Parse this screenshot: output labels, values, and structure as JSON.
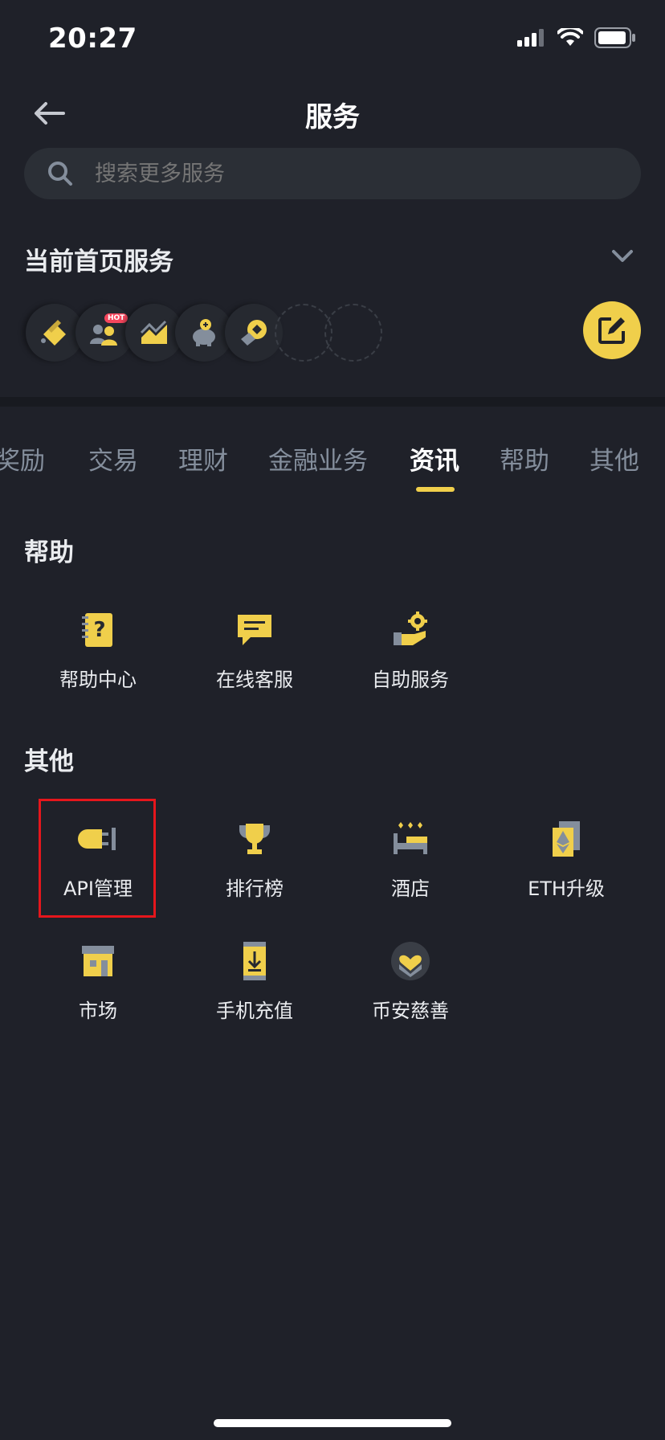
{
  "status_bar": {
    "time": "20:27"
  },
  "header": {
    "title": "服务"
  },
  "search": {
    "placeholder": "搜索更多服务"
  },
  "current_services": {
    "title": "当前首页服务",
    "hot_badge": "HOT",
    "slots": [
      "binance-card-icon",
      "referral-icon",
      "trading-chart-icon",
      "savings-piggy-icon",
      "pay-icon",
      "empty",
      "empty"
    ]
  },
  "tabs": [
    {
      "label": "奖励",
      "active": false
    },
    {
      "label": "交易",
      "active": false
    },
    {
      "label": "理财",
      "active": false
    },
    {
      "label": "金融业务",
      "active": false
    },
    {
      "label": "资讯",
      "active": true
    },
    {
      "label": "帮助",
      "active": false
    },
    {
      "label": "其他",
      "active": false
    }
  ],
  "groups": {
    "help": {
      "title": "帮助",
      "items": [
        {
          "label": "帮助中心",
          "icon": "help-center-icon"
        },
        {
          "label": "在线客服",
          "icon": "chat-icon"
        },
        {
          "label": "自助服务",
          "icon": "self-service-icon"
        }
      ]
    },
    "other": {
      "title": "其他",
      "items": [
        {
          "label": "API管理",
          "icon": "plug-icon"
        },
        {
          "label": "排行榜",
          "icon": "trophy-icon"
        },
        {
          "label": "酒店",
          "icon": "hotel-icon"
        },
        {
          "label": "ETH升级",
          "icon": "eth-icon"
        },
        {
          "label": "市场",
          "icon": "market-icon"
        },
        {
          "label": "手机充值",
          "icon": "phone-topup-icon"
        },
        {
          "label": "币安慈善",
          "icon": "charity-icon"
        }
      ]
    }
  },
  "colors": {
    "accent": "#F0CF4B",
    "background": "#1F2129",
    "highlight_box": "#E5161C"
  }
}
